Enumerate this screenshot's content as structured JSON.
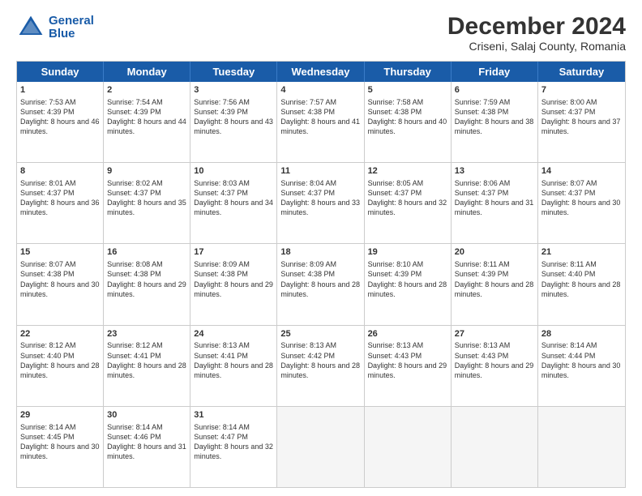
{
  "header": {
    "logo_line1": "General",
    "logo_line2": "Blue",
    "main_title": "December 2024",
    "subtitle": "Criseni, Salaj County, Romania"
  },
  "days": [
    "Sunday",
    "Monday",
    "Tuesday",
    "Wednesday",
    "Thursday",
    "Friday",
    "Saturday"
  ],
  "weeks": [
    [
      {
        "day": "1",
        "sunrise": "7:53 AM",
        "sunset": "4:39 PM",
        "daylight": "8 hours and 46 minutes."
      },
      {
        "day": "2",
        "sunrise": "7:54 AM",
        "sunset": "4:39 PM",
        "daylight": "8 hours and 44 minutes."
      },
      {
        "day": "3",
        "sunrise": "7:56 AM",
        "sunset": "4:39 PM",
        "daylight": "8 hours and 43 minutes."
      },
      {
        "day": "4",
        "sunrise": "7:57 AM",
        "sunset": "4:38 PM",
        "daylight": "8 hours and 41 minutes."
      },
      {
        "day": "5",
        "sunrise": "7:58 AM",
        "sunset": "4:38 PM",
        "daylight": "8 hours and 40 minutes."
      },
      {
        "day": "6",
        "sunrise": "7:59 AM",
        "sunset": "4:38 PM",
        "daylight": "8 hours and 38 minutes."
      },
      {
        "day": "7",
        "sunrise": "8:00 AM",
        "sunset": "4:37 PM",
        "daylight": "8 hours and 37 minutes."
      }
    ],
    [
      {
        "day": "8",
        "sunrise": "8:01 AM",
        "sunset": "4:37 PM",
        "daylight": "8 hours and 36 minutes."
      },
      {
        "day": "9",
        "sunrise": "8:02 AM",
        "sunset": "4:37 PM",
        "daylight": "8 hours and 35 minutes."
      },
      {
        "day": "10",
        "sunrise": "8:03 AM",
        "sunset": "4:37 PM",
        "daylight": "8 hours and 34 minutes."
      },
      {
        "day": "11",
        "sunrise": "8:04 AM",
        "sunset": "4:37 PM",
        "daylight": "8 hours and 33 minutes."
      },
      {
        "day": "12",
        "sunrise": "8:05 AM",
        "sunset": "4:37 PM",
        "daylight": "8 hours and 32 minutes."
      },
      {
        "day": "13",
        "sunrise": "8:06 AM",
        "sunset": "4:37 PM",
        "daylight": "8 hours and 31 minutes."
      },
      {
        "day": "14",
        "sunrise": "8:07 AM",
        "sunset": "4:37 PM",
        "daylight": "8 hours and 30 minutes."
      }
    ],
    [
      {
        "day": "15",
        "sunrise": "8:07 AM",
        "sunset": "4:38 PM",
        "daylight": "8 hours and 30 minutes."
      },
      {
        "day": "16",
        "sunrise": "8:08 AM",
        "sunset": "4:38 PM",
        "daylight": "8 hours and 29 minutes."
      },
      {
        "day": "17",
        "sunrise": "8:09 AM",
        "sunset": "4:38 PM",
        "daylight": "8 hours and 29 minutes."
      },
      {
        "day": "18",
        "sunrise": "8:09 AM",
        "sunset": "4:38 PM",
        "daylight": "8 hours and 28 minutes."
      },
      {
        "day": "19",
        "sunrise": "8:10 AM",
        "sunset": "4:39 PM",
        "daylight": "8 hours and 28 minutes."
      },
      {
        "day": "20",
        "sunrise": "8:11 AM",
        "sunset": "4:39 PM",
        "daylight": "8 hours and 28 minutes."
      },
      {
        "day": "21",
        "sunrise": "8:11 AM",
        "sunset": "4:40 PM",
        "daylight": "8 hours and 28 minutes."
      }
    ],
    [
      {
        "day": "22",
        "sunrise": "8:12 AM",
        "sunset": "4:40 PM",
        "daylight": "8 hours and 28 minutes."
      },
      {
        "day": "23",
        "sunrise": "8:12 AM",
        "sunset": "4:41 PM",
        "daylight": "8 hours and 28 minutes."
      },
      {
        "day": "24",
        "sunrise": "8:13 AM",
        "sunset": "4:41 PM",
        "daylight": "8 hours and 28 minutes."
      },
      {
        "day": "25",
        "sunrise": "8:13 AM",
        "sunset": "4:42 PM",
        "daylight": "8 hours and 28 minutes."
      },
      {
        "day": "26",
        "sunrise": "8:13 AM",
        "sunset": "4:43 PM",
        "daylight": "8 hours and 29 minutes."
      },
      {
        "day": "27",
        "sunrise": "8:13 AM",
        "sunset": "4:43 PM",
        "daylight": "8 hours and 29 minutes."
      },
      {
        "day": "28",
        "sunrise": "8:14 AM",
        "sunset": "4:44 PM",
        "daylight": "8 hours and 30 minutes."
      }
    ],
    [
      {
        "day": "29",
        "sunrise": "8:14 AM",
        "sunset": "4:45 PM",
        "daylight": "8 hours and 30 minutes."
      },
      {
        "day": "30",
        "sunrise": "8:14 AM",
        "sunset": "4:46 PM",
        "daylight": "8 hours and 31 minutes."
      },
      {
        "day": "31",
        "sunrise": "8:14 AM",
        "sunset": "4:47 PM",
        "daylight": "8 hours and 32 minutes."
      },
      null,
      null,
      null,
      null
    ]
  ]
}
